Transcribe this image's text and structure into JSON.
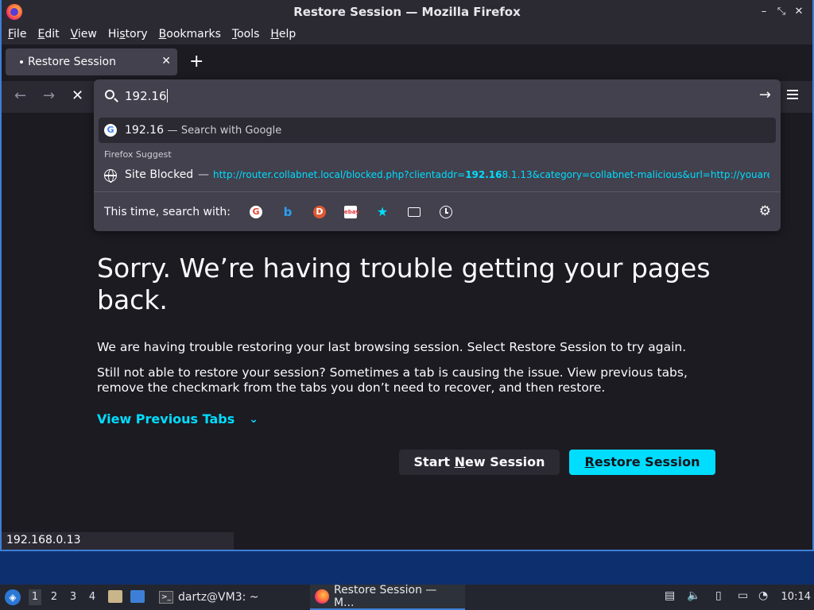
{
  "window": {
    "title": "Restore Session — Mozilla Firefox",
    "controls": {
      "minimize": "–",
      "restore": "⤡",
      "close": "✕"
    }
  },
  "menubar": {
    "items": [
      {
        "label": "File",
        "key": "F",
        "rest": "ile"
      },
      {
        "label": "Edit",
        "key": "E",
        "rest": "dit"
      },
      {
        "label": "View",
        "key": "V",
        "rest": "iew"
      },
      {
        "label": "History",
        "key": "s",
        "pre": "Hi",
        "rest": "tory"
      },
      {
        "label": "Bookmarks",
        "key": "B",
        "rest": "ookmarks"
      },
      {
        "label": "Tools",
        "key": "T",
        "rest": "ools"
      },
      {
        "label": "Help",
        "key": "H",
        "rest": "elp"
      }
    ]
  },
  "tabs": {
    "active_title": "Restore Session",
    "close_glyph": "✕",
    "new_tab_glyph": "+"
  },
  "navbar": {
    "back_glyph": "←",
    "forward_glyph": "→",
    "stop_glyph": "✕"
  },
  "urlbar": {
    "value": "192.16",
    "go_glyph": "→",
    "google_suggestion": {
      "query": "192.16",
      "separator": "—",
      "action": "Search with Google"
    },
    "section_header": "Firefox Suggest",
    "blocked": {
      "title": "Site Blocked",
      "separator": "—",
      "url_prefix": "http://router.collabnet.local/blocked.php?clientaddr=",
      "url_match": "192.16",
      "url_suffix": "8.1.13&category=collabnet-malicious&url=http://youare"
    },
    "engines_label": "This time, search with:",
    "engines": [
      "google-icon",
      "bing-icon",
      "duckduckgo-icon",
      "ebay-icon",
      "bookmarks-icon",
      "tabs-icon",
      "history-icon"
    ]
  },
  "page": {
    "heading": "Sorry. We’re having trouble getting your pages back.",
    "para1": "We are having trouble restoring your last browsing session. Select Restore Session to try again.",
    "para2": "Still not able to restore your session? Sometimes a tab is causing the issue. View previous tabs, remove the checkmark from the tabs you don’t need to recover, and then restore.",
    "view_previous": "View Previous Tabs",
    "start_new": {
      "pre": "Start ",
      "key": "N",
      "post": "ew Session"
    },
    "restore": {
      "key": "R",
      "post": "estore Session"
    }
  },
  "status_bar": "192.168.0.13",
  "taskbar": {
    "workspaces": [
      "1",
      "2",
      "3",
      "4"
    ],
    "active_workspace": "1",
    "terminal_task": "dartz@VM3: ~",
    "firefox_task": "Restore Session — M...",
    "clock": "10:14"
  },
  "colors": {
    "accent": "#00ddff",
    "toolbar": "#2b2a33",
    "background": "#1c1b22",
    "window_border": "#3d7fd6"
  }
}
